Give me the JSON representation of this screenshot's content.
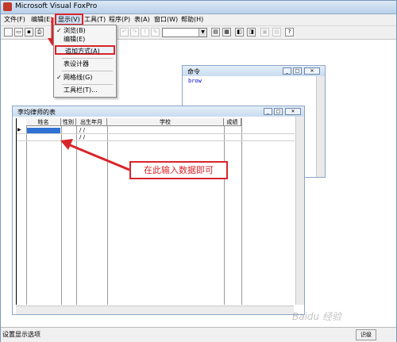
{
  "window": {
    "title": "Microsoft Visual FoxPro"
  },
  "menubar": [
    "文件(F)",
    "编辑(E)",
    "显示(V)",
    "工具(T)",
    "程序(P)",
    "表(A)",
    "窗口(W)",
    "帮助(H)"
  ],
  "view_menu": {
    "items": [
      {
        "label": "浏览(B)",
        "checked": true
      },
      {
        "label": "编辑(E)",
        "checked": false
      },
      {
        "label": "追加方式(A)",
        "checked": false,
        "highlighted": true
      },
      {
        "label": "表设计器",
        "checked": false
      },
      {
        "label": "网格线(G)",
        "checked": true
      },
      {
        "label": "工具栏(T)...",
        "checked": false
      }
    ]
  },
  "command_window": {
    "title": "命令",
    "content": "brow"
  },
  "browse_window": {
    "title": "李均律师的表",
    "columns": [
      "姓名",
      "性别",
      "出生年月",
      "学校",
      "成绩"
    ],
    "rows": [
      {
        "date": "/  /"
      },
      {
        "date": "/  /"
      }
    ]
  },
  "callout": {
    "text": "在此输入数据即可"
  },
  "statusbar": {
    "text": "设置显示选项",
    "indicator": "识级"
  },
  "watermark": {
    "text": "Baidu 经验"
  },
  "colors": {
    "highlight": "#d9252a",
    "selection": "#2f72d4",
    "title_bar": "#c9dcf0"
  }
}
